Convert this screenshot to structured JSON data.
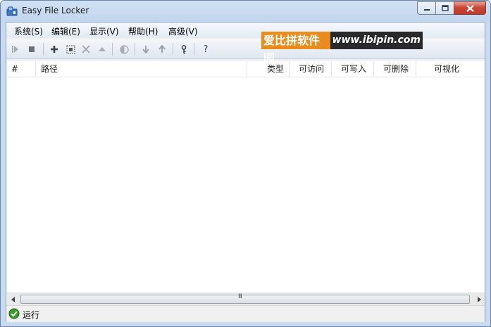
{
  "window": {
    "title": "Easy File Locker"
  },
  "menu": [
    "系统(S)",
    "编辑(E)",
    "显示(V)",
    "帮助(H)",
    "高级(V)"
  ],
  "toolbar_icons": [
    "play-icon",
    "stop-icon",
    "add-icon",
    "expand-icon",
    "remove-icon",
    "up-triangle-icon",
    "toggle-icon",
    "move-down-icon",
    "move-up-icon",
    "key-icon",
    "help-icon"
  ],
  "help_glyph": "?",
  "watermark": {
    "cn": "爱比拼软件园",
    "en": "www.ibipin.com"
  },
  "columns": {
    "num": "#",
    "path": "路径",
    "type": "类型",
    "access": "可访问",
    "write": "可写入",
    "delete": "可删除",
    "visible": "可视化"
  },
  "scrollbar": {
    "grip": "III"
  },
  "status": {
    "text": "运行"
  },
  "colors": {
    "accent": "#2f7d1f",
    "watermark_orange": "#e98b1d"
  }
}
